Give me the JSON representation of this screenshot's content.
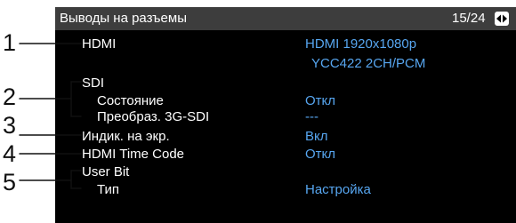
{
  "callouts": [
    "1",
    "2",
    "3",
    "4",
    "5"
  ],
  "header": {
    "title": "Выводы на разъемы",
    "page": "15/24",
    "nav_icon": "page-switch-icon"
  },
  "items": {
    "hdmi": {
      "label": "HDMI",
      "value_line1": "HDMI 1920x1080p",
      "value_line2": "YCC422 2CH/PCM"
    },
    "sdi": {
      "label": "SDI",
      "status": {
        "label": "Состояние",
        "value": "Откл"
      },
      "conv": {
        "label": "Преобраз. 3G-SDI",
        "value": "---"
      }
    },
    "osd": {
      "label": "Индик. на экр.",
      "value": "Вкл"
    },
    "hdmi_tc": {
      "label": "HDMI Time Code",
      "value": "Откл"
    },
    "user_bit": {
      "label": "User Bit",
      "type": {
        "label": "Тип",
        "value": "Настройка"
      }
    }
  },
  "colors": {
    "screen_bg": "#000000",
    "header_bg": "#3d3d3d",
    "label": "#ffffff",
    "value": "#57a6f0"
  }
}
